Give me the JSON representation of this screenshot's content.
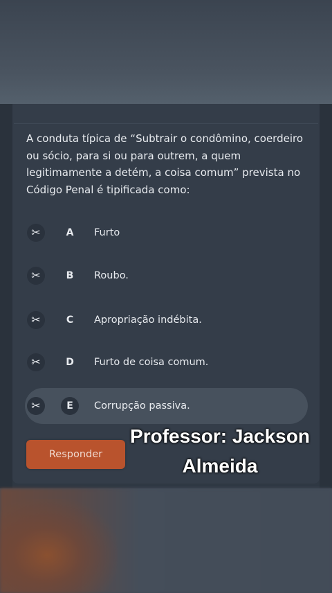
{
  "question": {
    "text": "A conduta típica de “Subtrair o condômino, coerdeiro\nou sócio, para si ou para outrem, a quem\nlegitimamente a detém, a coisa comum” prevista no\nCódigo Penal é tipificada como:"
  },
  "options": [
    {
      "letter": "A",
      "text": "Furto",
      "selected": false
    },
    {
      "letter": "B",
      "text": "Roubo.",
      "selected": false
    },
    {
      "letter": "C",
      "text": "Apropriação indébita.",
      "selected": false
    },
    {
      "letter": "D",
      "text": "Furto de coisa comum.",
      "selected": false
    },
    {
      "letter": "E",
      "text": "Corrupção passiva.",
      "selected": true
    }
  ],
  "cut_icon_glyph": "✂",
  "answer_button": {
    "label": "Responder"
  },
  "watermark": {
    "text": "Professor: Jackson\nAlmeida"
  },
  "colors": {
    "card_bg": "#343d49",
    "selected_bg": "#47515d",
    "button_bg": "#b9532d",
    "text": "#e8ebef"
  }
}
